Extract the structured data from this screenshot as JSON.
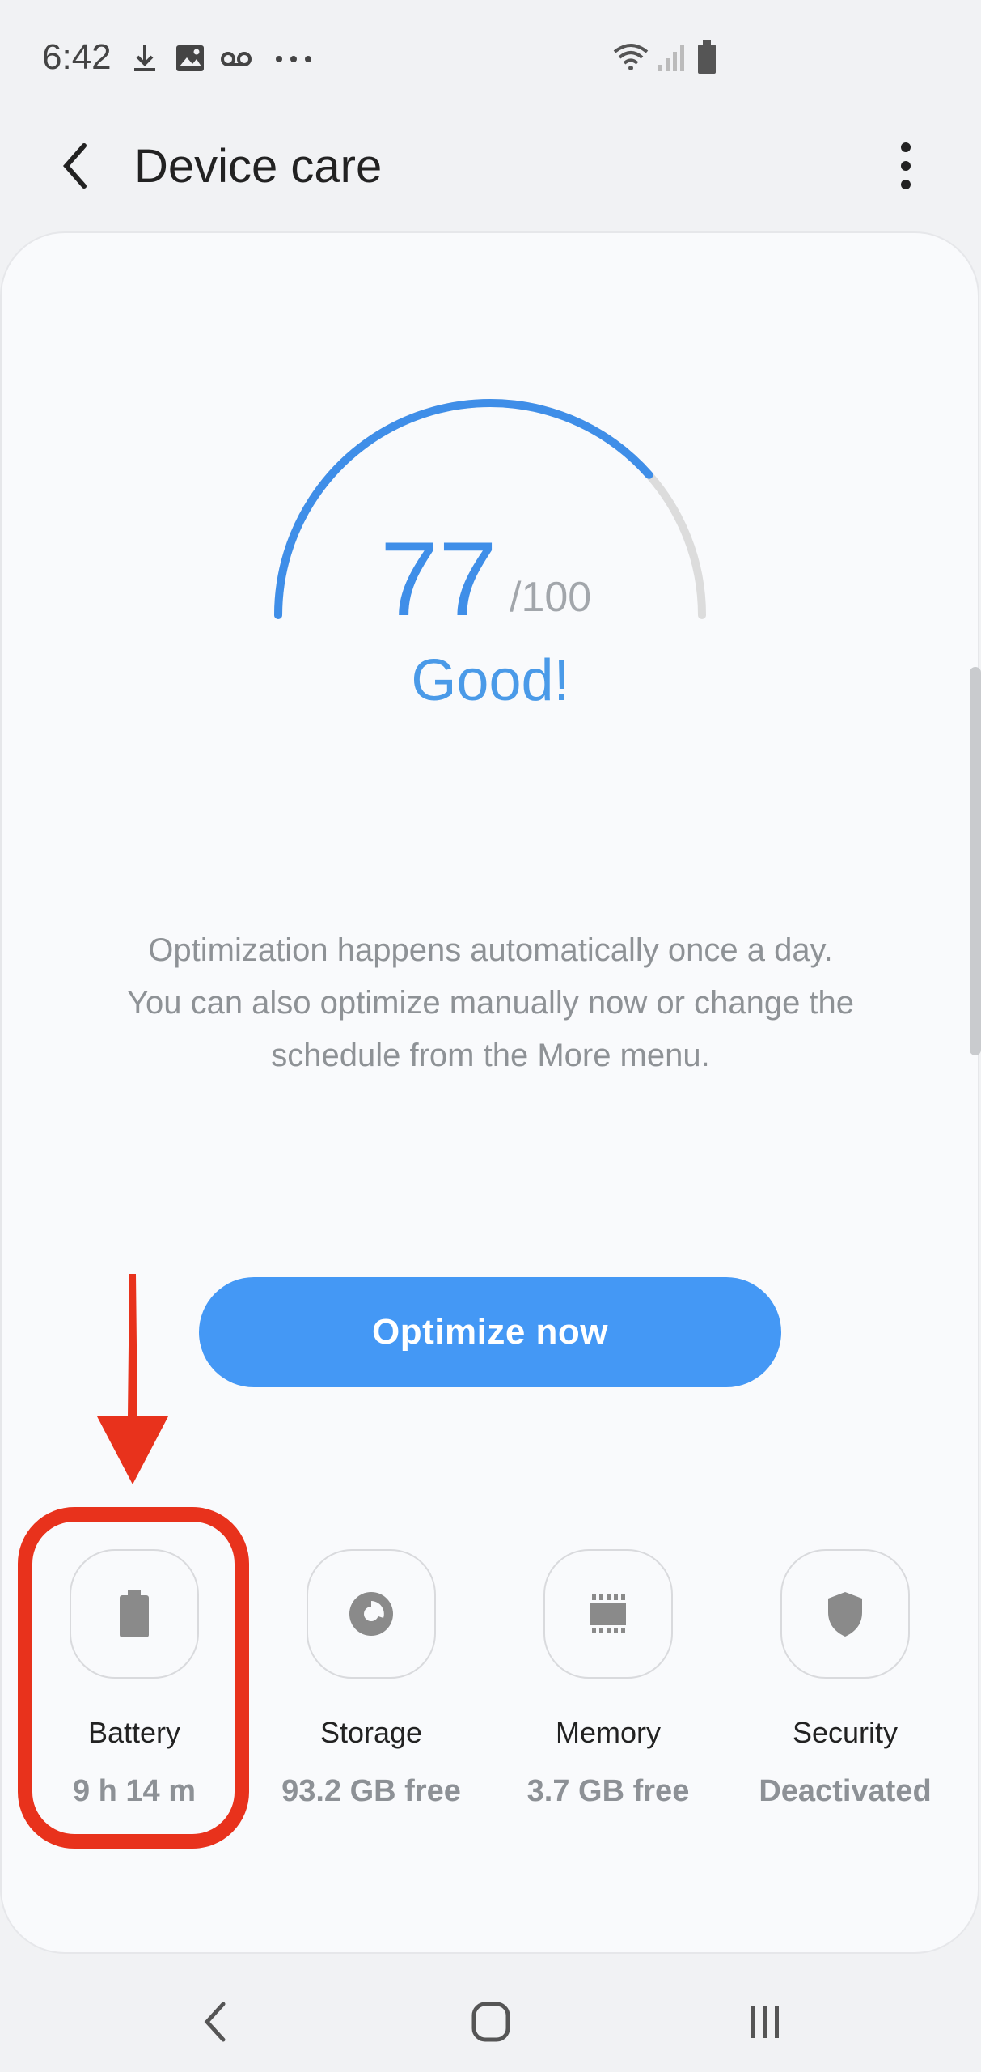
{
  "status_bar": {
    "time": "6:42",
    "notification_icons": [
      "download-icon",
      "image-icon",
      "voicemail-icon",
      "more-notifications-icon"
    ],
    "system_icons": [
      "wifi-icon",
      "signal-icon",
      "battery-status-icon"
    ]
  },
  "app_bar": {
    "title": "Device care",
    "back_icon": "chevron-left-icon",
    "more_icon": "more-vert-icon"
  },
  "score": {
    "value": "77",
    "max": "/100",
    "status": "Good!",
    "fraction": 0.77
  },
  "description_lines": [
    "Optimization happens automatically once a day.",
    "You can also optimize manually now or change the",
    "schedule from the More menu."
  ],
  "optimize_button": {
    "label": "Optimize now"
  },
  "tiles": [
    {
      "label": "Battery",
      "value": "9 h 14 m",
      "icon": "battery-icon"
    },
    {
      "label": "Storage",
      "value": "93.2 GB free",
      "icon": "storage-icon"
    },
    {
      "label": "Memory",
      "value": "3.7 GB free",
      "icon": "memory-icon"
    },
    {
      "label": "Security",
      "value": "Deactivated",
      "icon": "shield-icon"
    }
  ],
  "colors": {
    "accent": "#4498f5",
    "score_text": "#3f8ee8",
    "gauge_track": "#dcdcdc",
    "annotation": "#e8321c"
  },
  "nav_bar": [
    "back-nav-icon",
    "home-nav-icon",
    "recents-nav-icon"
  ]
}
